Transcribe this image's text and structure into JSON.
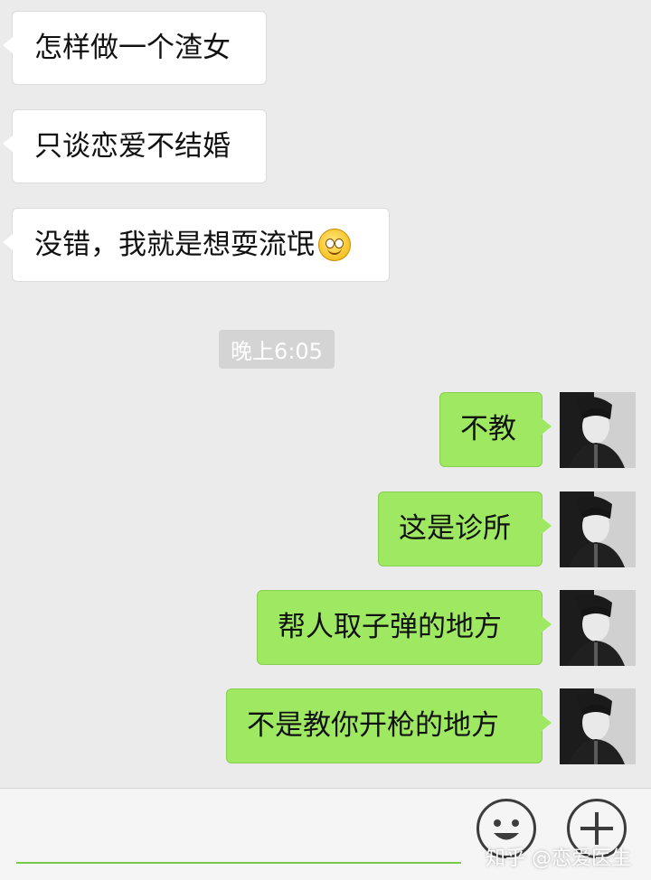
{
  "messages_in": [
    {
      "text": "怎样做一个渣女"
    },
    {
      "text": "只谈恋爱不结婚"
    },
    {
      "text": "没错，我就是想耍流氓",
      "emoji": "smile-emoji-icon"
    }
  ],
  "timestamp": "晚上6:05",
  "messages_out": [
    {
      "text": "不教"
    },
    {
      "text": "这是诊所"
    },
    {
      "text": "帮人取子弹的地方"
    },
    {
      "text": "不是教你开枪的地方"
    }
  ],
  "input_bar": {
    "emoji_button": "face-icon",
    "plus_button": "plus-icon"
  },
  "watermark": "知乎 @恋爱医生",
  "colors": {
    "background": "#ebebeb",
    "incoming": "#ffffff",
    "outgoing": "#9ee862"
  }
}
